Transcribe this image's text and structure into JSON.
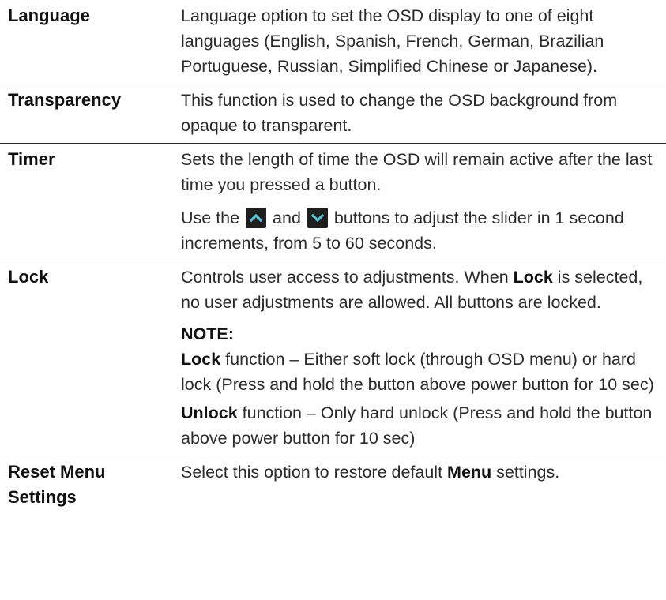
{
  "rows": [
    {
      "term": "Language",
      "desc": "Language option to set the OSD display to one of eight languages (English, Spanish, French, German, Brazilian Portuguese, Russian, Simplified Chinese or Japanese)."
    },
    {
      "term": "Transparency",
      "desc": "This function is used to change the OSD background from opaque to transparent."
    },
    {
      "term": "Timer",
      "desc": "Sets the length of time the OSD will remain active after the last time you pressed a button.",
      "desc2_part1": "Use the ",
      "desc2_part2": " and ",
      "desc2_part3": " buttons to adjust the slider in 1 second increments, from 5 to 60 seconds.",
      "icons": [
        "up-arrow-button-icon",
        "down-arrow-button-icon"
      ],
      "icon_bg": "#1e1e1e",
      "icon_up_color": "#4fc3d9",
      "icon_down_color": "#4fc3d9"
    },
    {
      "term": "Lock",
      "desc_part1": "Controls user access to adjustments. When ",
      "desc_bold": "Lock",
      "desc_part2": " is selected, no user adjustments are allowed. All buttons are locked.",
      "note_title": "NOTE:",
      "note1_bold": "Lock",
      "note1_text": " function – Either soft lock (through OSD menu) or hard lock (Press and hold the button above power button for 10 sec)",
      "note2_bold": "Unlock",
      "note2_text": " function – Only hard unlock (Press and hold the button above power button for 10 sec)"
    },
    {
      "term_line1": "Reset Menu",
      "term_line2": "Settings",
      "desc_part1": "Select this option to restore default ",
      "desc_bold": "Menu",
      "desc_part2": " settings."
    }
  ]
}
